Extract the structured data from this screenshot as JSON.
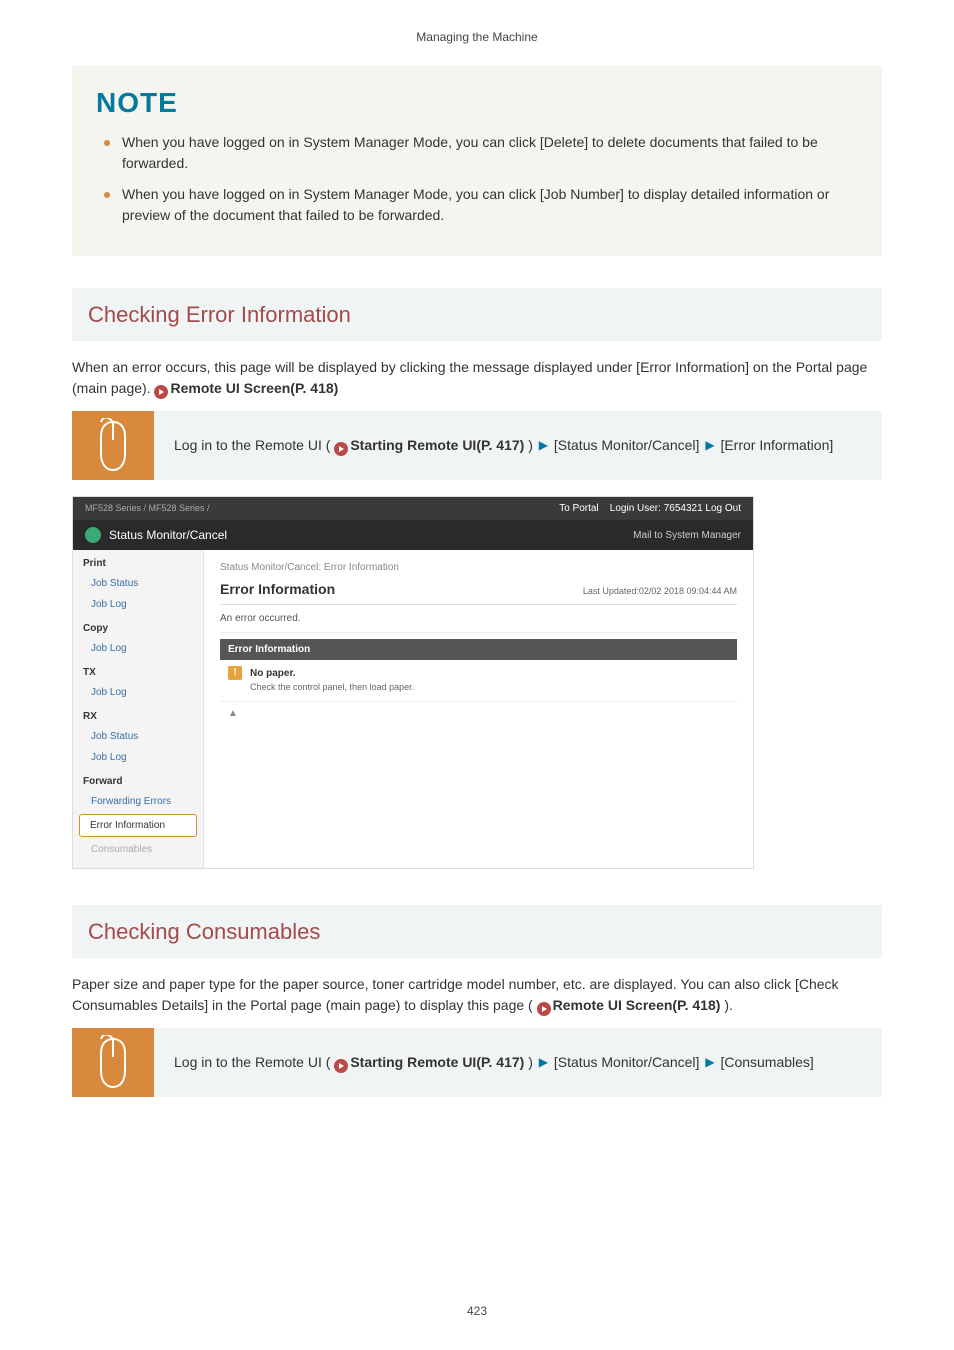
{
  "running_header": "Managing the Machine",
  "note": {
    "title": "NOTE",
    "items": [
      "When you have logged on in System Manager Mode, you can click [Delete] to delete documents that failed to be forwarded.",
      "When you have logged on in System Manager Mode, you can click [Job Number] to display detailed information or preview of the document that failed to be forwarded."
    ]
  },
  "section1": {
    "heading": "Checking Error Information",
    "intro_pre": "When an error occurs, this page will be displayed by clicking the message displayed under [Error Information] on the Portal page (main page). ",
    "intro_link": "Remote UI Screen(P. 418)",
    "instruction": {
      "prefix": "Log in to the Remote UI ( ",
      "link": "Starting Remote UI(P. 417)",
      "mid": " ) ",
      "step_a": "[Status Monitor/Cancel]",
      "step_b": "[Error Information]"
    }
  },
  "screenshot": {
    "model_line": "MF528 Series / MF528 Series /",
    "to_portal": "To Portal",
    "login_user": "Login User:  7654321  Log Out",
    "left_title": "Status Monitor/Cancel",
    "mail_link": "Mail to System Manager",
    "breadcrumb": "Status Monitor/Cancel: Error Information",
    "title": "Error Information",
    "updated": "Last Updated:02/02 2018 09:04:44 AM",
    "an_error": "An error occurred.",
    "section_header": "Error Information",
    "err_title": "No paper.",
    "err_desc": "Check the control panel, then load paper.",
    "pager": "▲",
    "side": {
      "g1": "Print",
      "g1a": "Job Status",
      "g1b": "Job Log",
      "g2": "Copy",
      "g2a": "Job Log",
      "g3": "TX",
      "g3a": "Job Log",
      "g4": "RX",
      "g4a": "Job Status",
      "g4b": "Job Log",
      "g5": "Forward",
      "g5a": "Forwarding Errors",
      "active": "Error Information",
      "muted": "Consumables"
    }
  },
  "section2": {
    "heading": "Checking Consumables",
    "intro_pre": "Paper size and paper type for the paper source, toner cartridge model number, etc. are displayed. You can also click [Check Consumables Details] in the Portal page (main page) to display this page ( ",
    "intro_link": "Remote UI Screen(P. 418)",
    "intro_post": " ).",
    "instruction": {
      "prefix": "Log in to the Remote UI ( ",
      "link": "Starting Remote UI(P. 417)",
      "mid": " ) ",
      "step_a": "[Status Monitor/Cancel]",
      "step_b": "[Consumables]"
    }
  },
  "page_number": "423"
}
